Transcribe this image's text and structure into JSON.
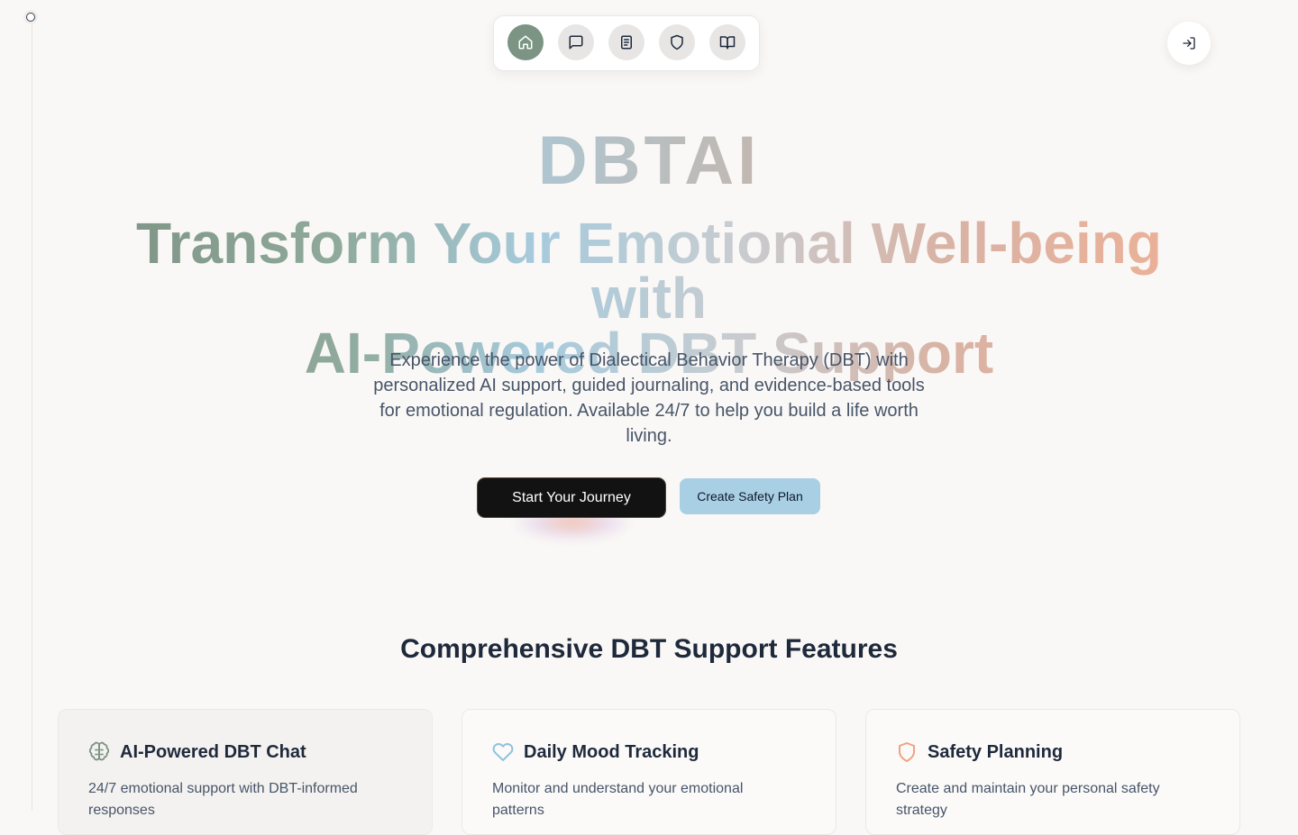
{
  "nav": {
    "items": [
      {
        "name": "home",
        "icon": "home-icon",
        "active": true
      },
      {
        "name": "chat",
        "icon": "message-square-icon",
        "active": false
      },
      {
        "name": "journal",
        "icon": "notebook-icon",
        "active": false
      },
      {
        "name": "safety",
        "icon": "shield-icon",
        "active": false
      },
      {
        "name": "resources",
        "icon": "book-open-icon",
        "active": false
      }
    ],
    "login_icon": "log-in-icon"
  },
  "hero": {
    "logo": "DBTAI",
    "title_line1": "Transform Your Emotional Well-being with",
    "title_line2": "AI-Powered DBT Support",
    "subtitle": "Experience the power of Dialectical Behavior Therapy (DBT) with personalized AI support, guided journaling, and evidence-based tools for emotional regulation. Available 24/7 to help you build a life worth living.",
    "primary_cta": "Start Your Journey",
    "secondary_cta": "Create Safety Plan"
  },
  "features": {
    "title": "Comprehensive DBT Support Features",
    "cards": [
      {
        "title": "AI-Powered DBT Chat",
        "text": "24/7 emotional support with DBT-informed responses",
        "icon": "brain-icon",
        "color": "#7b9483"
      },
      {
        "title": "Daily Mood Tracking",
        "text": "Monitor and understand your emotional patterns",
        "icon": "heart-icon",
        "color": "#8fc3dd"
      },
      {
        "title": "Safety Planning",
        "text": "Create and maintain your personal safety strategy",
        "icon": "shield-icon",
        "color": "#eea37e"
      }
    ]
  },
  "colors": {
    "background": "#faf8f6",
    "sage": "#7b9483",
    "sky": "#a8cfe3",
    "peach": "#eeb096",
    "dark": "#121212"
  }
}
